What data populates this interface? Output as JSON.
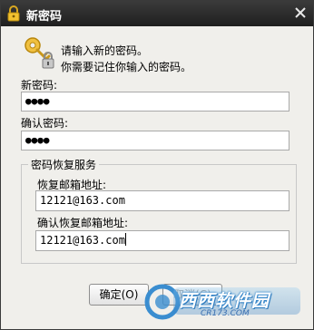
{
  "window": {
    "title": "新密码",
    "icons": {
      "title": "lock-icon",
      "close": "close-icon",
      "info": "key-lock-icon"
    }
  },
  "info": {
    "line1": "请输入新的密码。",
    "line2": "你需要记住你输入的密码。"
  },
  "form": {
    "new_password_label": "新密码:",
    "new_password_value": "●●●●",
    "confirm_password_label": "确认密码:",
    "confirm_password_value": "●●●●"
  },
  "recovery": {
    "group_title": "密码恢复服务",
    "email_label": "恢复邮箱地址:",
    "email_value": "12121@163.com",
    "confirm_email_label": "确认恢复邮箱地址:",
    "confirm_email_value": "12121@163.com"
  },
  "buttons": {
    "ok": "确定(O)",
    "cancel": "取消(C)"
  },
  "watermark": {
    "text": "西西软件园",
    "sub": "CR173.COM"
  }
}
